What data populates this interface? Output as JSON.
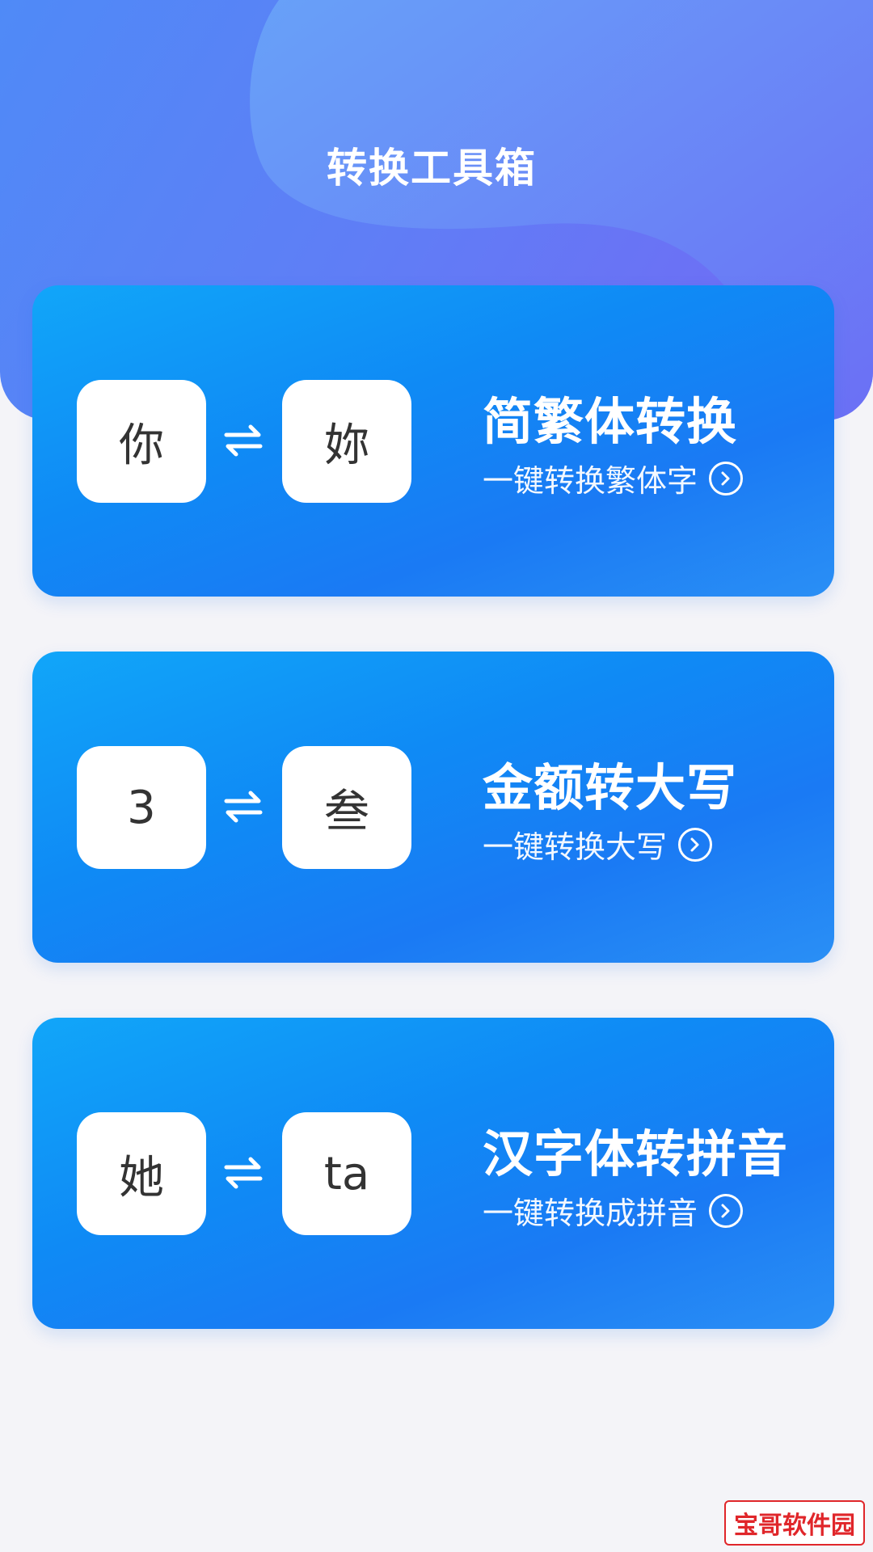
{
  "header": {
    "title": "转换工具箱"
  },
  "cards": [
    {
      "from_char": "你",
      "to_char": "妳",
      "title": "简繁体转换",
      "link_text": "一键转换繁体字"
    },
    {
      "from_char": "3",
      "to_char": "叁",
      "title": "金额转大写",
      "link_text": "一键转换大写"
    },
    {
      "from_char": "她",
      "to_char": "ta",
      "title": "汉字体转拼音",
      "link_text": "一键转换成拼音"
    }
  ],
  "watermark": {
    "text": "宝哥软件园"
  },
  "colors": {
    "header_start": "#4f8af7",
    "header_end": "#7468f4",
    "card_start": "#11a6f9",
    "card_end": "#1a7af4",
    "background": "#f4f4f8",
    "watermark": "#e0262a"
  },
  "icons": {
    "swap": "swap-arrows-icon",
    "chevron": "chevron-right-circle-icon"
  }
}
